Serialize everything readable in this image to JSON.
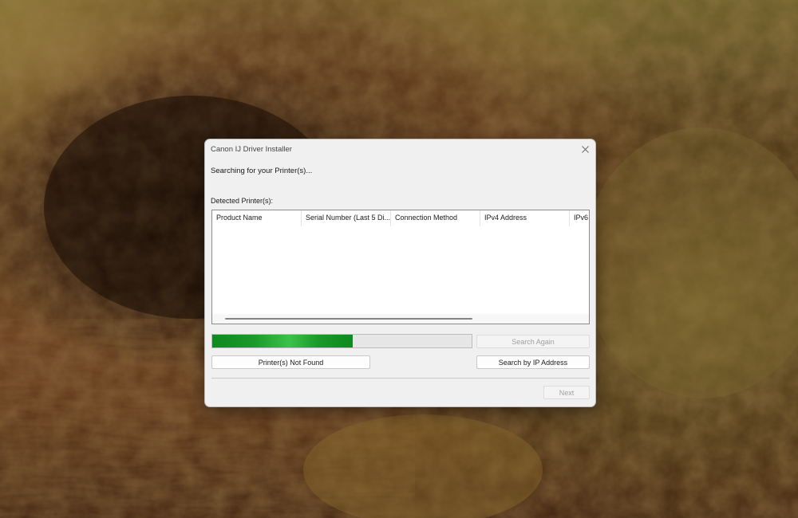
{
  "window": {
    "title": "Canon IJ Driver Installer",
    "close_icon": "close-icon"
  },
  "status_text": "Searching for your Printer(s)...",
  "detected_label": "Detected Printer(s):",
  "table": {
    "columns": [
      "Product Name",
      "Serial Number (Last 5 Di...",
      "Connection Method",
      "IPv4 Address",
      "IPv6"
    ],
    "rows": []
  },
  "progress": {
    "value_percent": 54,
    "color": "#1a9a2a"
  },
  "buttons": {
    "search_again": "Search Again",
    "printers_not_found": "Printer(s) Not Found",
    "search_by_ip": "Search by IP Address",
    "next": "Next"
  }
}
